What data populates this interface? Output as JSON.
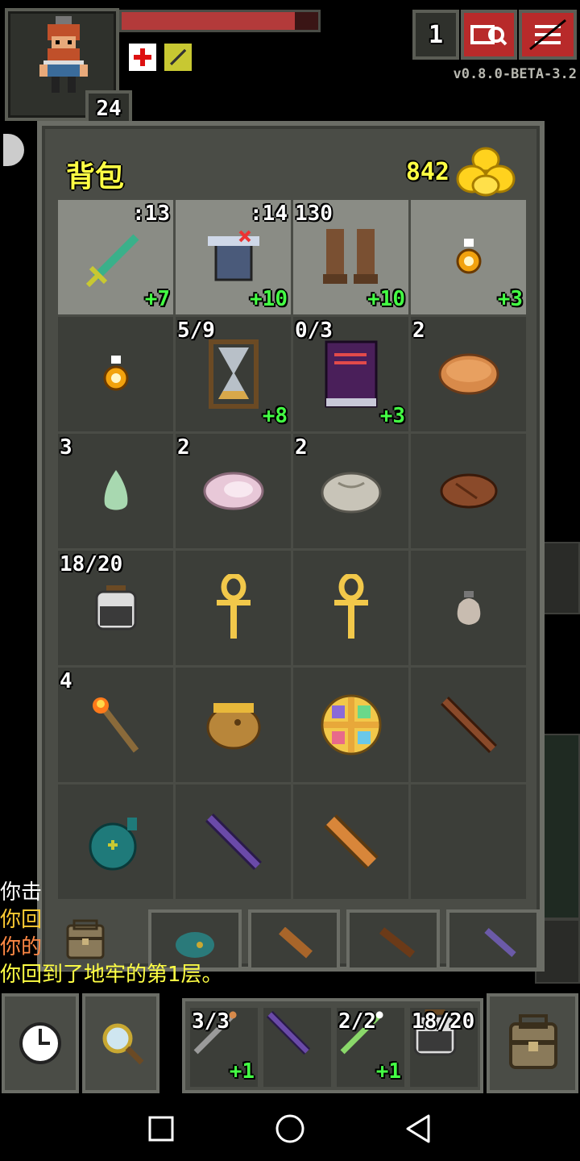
{
  "hud": {
    "depth": "24",
    "keys_count": "1",
    "version": "v0.8.0-BETA-3.2",
    "hp_fraction": 0.88,
    "buffs": [
      "healing-buff-icon",
      "weapon-buff-icon"
    ]
  },
  "bag": {
    "title": "背包",
    "gold": "842",
    "slots": [
      {
        "item": "sword",
        "tr": ":13",
        "br": "+7",
        "equipped": true
      },
      {
        "item": "armor",
        "tr": ":14",
        "br": "+10",
        "equipped": true
      },
      {
        "item": "boots",
        "tl": "130",
        "br": "+10",
        "equipped": true
      },
      {
        "item": "ring",
        "br": "+3",
        "equipped": true
      },
      {
        "item": "ring",
        "equipped": false
      },
      {
        "item": "hourglass",
        "tl": "5/9",
        "br": "+8",
        "equipped": false
      },
      {
        "item": "spellbook",
        "tl": "0/3",
        "br": "+3",
        "equipped": false
      },
      {
        "item": "pasty",
        "tl": "2",
        "equipped": false
      },
      {
        "item": "seed",
        "tl": "3",
        "equipped": false
      },
      {
        "item": "meat-pink",
        "tl": "2",
        "equipped": false
      },
      {
        "item": "stone",
        "tl": "2",
        "equipped": false
      },
      {
        "item": "meat-brown",
        "equipped": false
      },
      {
        "item": "waterskin",
        "tl": "18/20",
        "equipped": false
      },
      {
        "item": "ankh",
        "equipped": false
      },
      {
        "item": "ankh",
        "equipped": false
      },
      {
        "item": "pouch-small",
        "equipped": false
      },
      {
        "item": "torch",
        "tl": "4",
        "equipped": false
      },
      {
        "item": "honeypot",
        "equipped": false
      },
      {
        "item": "wheel",
        "equipped": false
      },
      {
        "item": "wand-brown",
        "equipped": false
      },
      {
        "item": "bomb",
        "equipped": false
      },
      {
        "item": "wand-purple",
        "equipped": false
      },
      {
        "item": "scroll-holder",
        "equipped": false
      },
      {
        "item": "empty",
        "equipped": false
      }
    ]
  },
  "log": [
    {
      "text": "你击",
      "color": "#ffffff"
    },
    {
      "text": "你回",
      "color": "#ffcc33"
    },
    {
      "text": "你的",
      "color": "#ff8844"
    },
    {
      "text": "你回到了地牢的第1层。",
      "color": "#ffff44"
    }
  ],
  "quickslots": [
    {
      "tl": "3/3",
      "br": "+1",
      "item": "wand-gray"
    },
    {
      "item": "wand-purple"
    },
    {
      "tl": "2/2",
      "br": "+1",
      "item": "wand-green"
    },
    {
      "tl": "18/20",
      "item": "waterskin"
    }
  ],
  "colors": {
    "panel": "#4a4c46",
    "slot": "#3c3e39",
    "equipped_slot": "#8a8c85",
    "upgrade": "#44ff44",
    "gold": "#ffff44"
  }
}
